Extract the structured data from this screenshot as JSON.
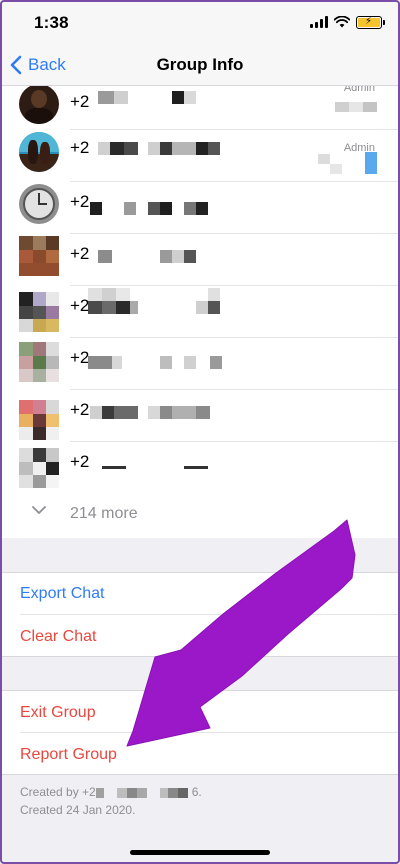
{
  "status_bar": {
    "time": "1:38"
  },
  "nav": {
    "back_label": "Back",
    "title": "Group Info"
  },
  "members": [
    {
      "phone_prefix": "+2",
      "role": "Admin"
    },
    {
      "phone_prefix": "+2",
      "role": "Admin"
    },
    {
      "phone_prefix": "+2"
    },
    {
      "phone_prefix": "+2"
    },
    {
      "phone_prefix": "+2"
    },
    {
      "phone_prefix": "+2"
    },
    {
      "phone_prefix": "+2"
    },
    {
      "phone_prefix": "+2"
    }
  ],
  "more": {
    "label": "214 more"
  },
  "actions": {
    "export_chat": "Export Chat",
    "clear_chat": "Clear Chat",
    "exit_group": "Exit Group",
    "report_group": "Report Group"
  },
  "footer": {
    "created_by_prefix": "Created by +2",
    "created_by_suffix": "6.",
    "created_on": "Created 24 Jan 2020."
  },
  "colors": {
    "accent_blue": "#2f7cf6",
    "destructive_red": "#e8483f",
    "annotation_arrow": "#9b18c8"
  }
}
